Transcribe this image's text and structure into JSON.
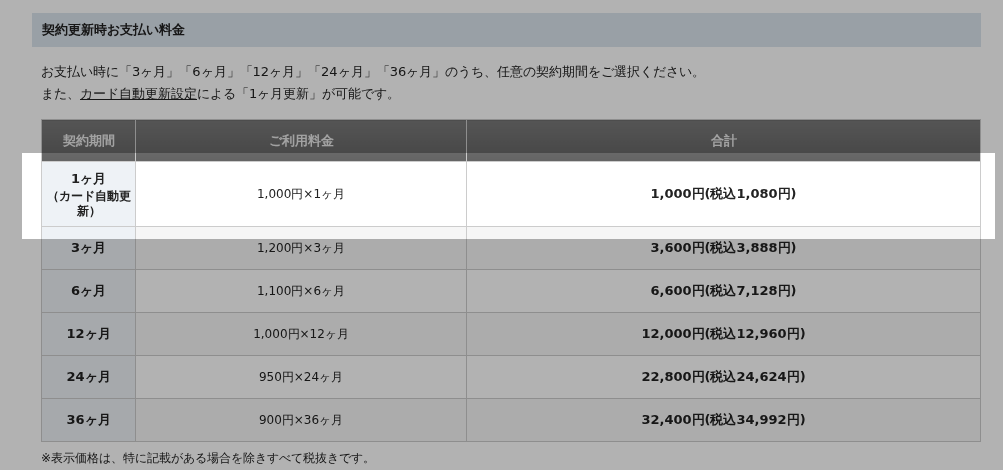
{
  "section_title": "契約更新時お支払い料金",
  "intro": {
    "line1": "お支払い時に「3ヶ月」「6ヶ月」「12ヶ月」「24ヶ月」「36ヶ月」のうち、任意の契約期間をご選択ください。",
    "line2_before": "また、",
    "link": "カード自動更新設定",
    "line2_after": "による「1ヶ月更新」が可能です。"
  },
  "table": {
    "columns": [
      "契約期間",
      "ご利用料金",
      "合計"
    ],
    "rows": [
      {
        "period": "1ヶ月",
        "note": "（カード自動更新）",
        "fee": "1,000円×1ヶ月",
        "total": "1,000円(税込1,080円)",
        "spotlight": true
      },
      {
        "period": "3ヶ月",
        "fee": "1,200円×3ヶ月",
        "total": "3,600円(税込3,888円)",
        "spotlight": false
      },
      {
        "period": "6ヶ月",
        "fee": "1,100円×6ヶ月",
        "total": "6,600円(税込7,128円)",
        "spotlight": false
      },
      {
        "period": "12ヶ月",
        "fee": "1,000円×12ヶ月",
        "total": "12,000円(税込12,960円)",
        "spotlight": false
      },
      {
        "period": "24ヶ月",
        "fee": "950円×24ヶ月",
        "total": "22,800円(税込24,624円)",
        "spotlight": false
      },
      {
        "period": "36ヶ月",
        "fee": "900円×36ヶ月",
        "total": "32,400円(税込34,992円)",
        "spotlight": false
      }
    ]
  },
  "footnote": "※表示価格は、特に記載がある場合を除きすべて税抜きです。"
}
